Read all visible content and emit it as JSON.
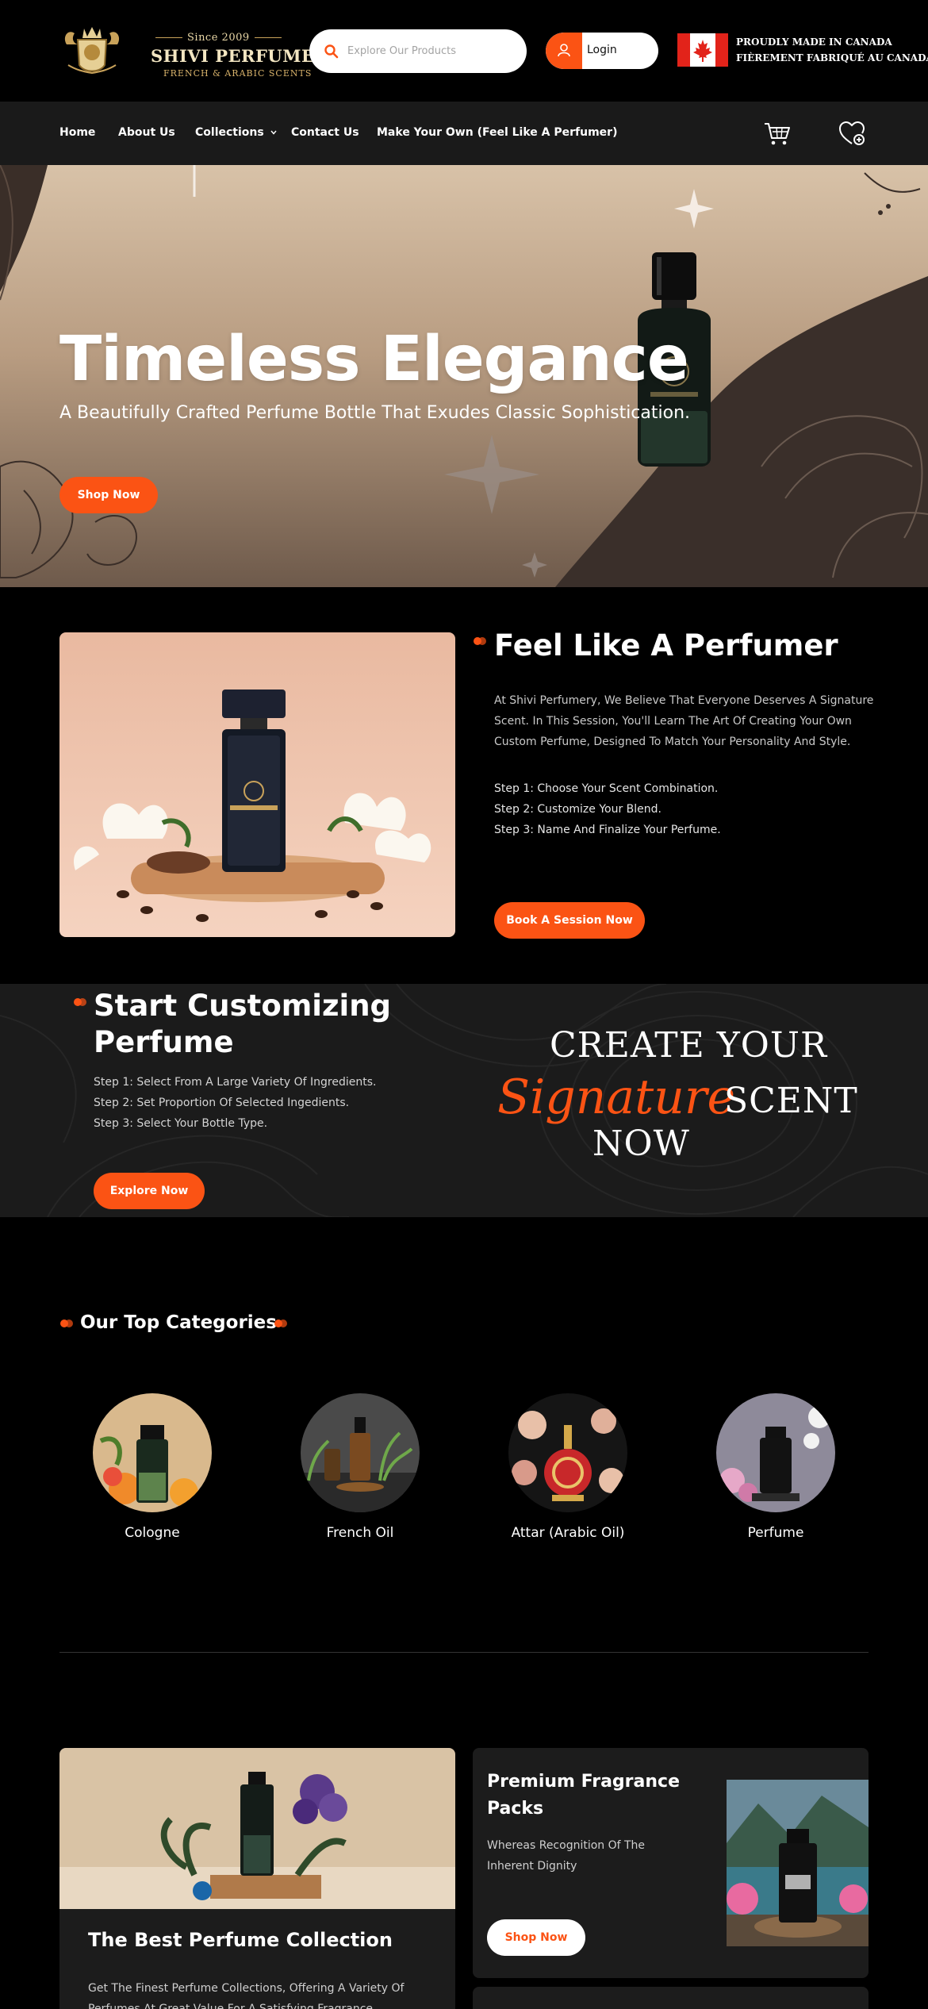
{
  "brand": {
    "since": "Since 2009",
    "name": "SHIVI PERFUMERY",
    "tagline": "FRENCH & ARABIC SCENTS"
  },
  "search": {
    "placeholder": "Explore Our Products"
  },
  "login": {
    "label": "Login"
  },
  "made_in": {
    "line1": "PROUDLY MADE IN CANADA",
    "line2": "FIÈREMENT FABRIQUÉ AU CANADA"
  },
  "nav": {
    "items": [
      "Home",
      "About Us",
      "Collections",
      "Contact Us",
      "Make Your Own (Feel Like A Perfumer)"
    ],
    "collections_chevron": "⌄"
  },
  "hero": {
    "title": "Timeless Elegance",
    "subtitle": "A Beautifully Crafted Perfume Bottle That Exudes Classic Sophistication.",
    "button": "Shop Now"
  },
  "feel": {
    "title": "Feel Like A Perfumer",
    "description": "At Shivi Perfumery, We Believe That Everyone Deserves A Signature Scent. In This Session, You'll Learn The Art Of Creating Your Own Custom Perfume, Designed To Match Your Personality And Style.",
    "steps": [
      "Step 1: Choose Your Scent Combination.",
      "Step 2: Customize Your Blend.",
      "Step 3: Name And Finalize Your Perfume."
    ],
    "button": "Book A Session Now"
  },
  "customize": {
    "title_line1": "Start Customizing",
    "title_line2": "Perfume",
    "steps": [
      "Step 1: Select From A Large Variety Of Ingredients.",
      "Step 2: Set Proportion Of Selected Ingedients.",
      "Step 3: Select Your Bottle Type."
    ],
    "button": "Explore Now",
    "signature": {
      "line1": "CREATE YOUR",
      "script": "Signature",
      "line2": "SCENT",
      "line3": "NOW"
    }
  },
  "categories": {
    "title": "Our Top Categories",
    "items": [
      {
        "label": "Cologne"
      },
      {
        "label": "French Oil"
      },
      {
        "label": "Attar (Arabic Oil)"
      },
      {
        "label": "Perfume"
      }
    ]
  },
  "cards": {
    "collection": {
      "title": "The Best Perfume Collection",
      "description": "Get The Finest Perfume Collections, Offering A Variety Of Perfumes At Great Value For A Satisfying Fragrance"
    },
    "packs": {
      "title": "Premium Fragrance Packs",
      "description": "Whereas Recognition Of The Inherent Dignity",
      "button": "Shop Now"
    }
  },
  "colors": {
    "accent": "#fb5314",
    "background": "#000000",
    "nav_background": "#1a1a1a",
    "card_background": "#1c1c1c"
  },
  "icons": [
    "search-icon",
    "user-icon",
    "canada-flag-icon",
    "chevron-down-icon",
    "cart-icon",
    "heart-plus-icon",
    "accent-dot-icon"
  ]
}
